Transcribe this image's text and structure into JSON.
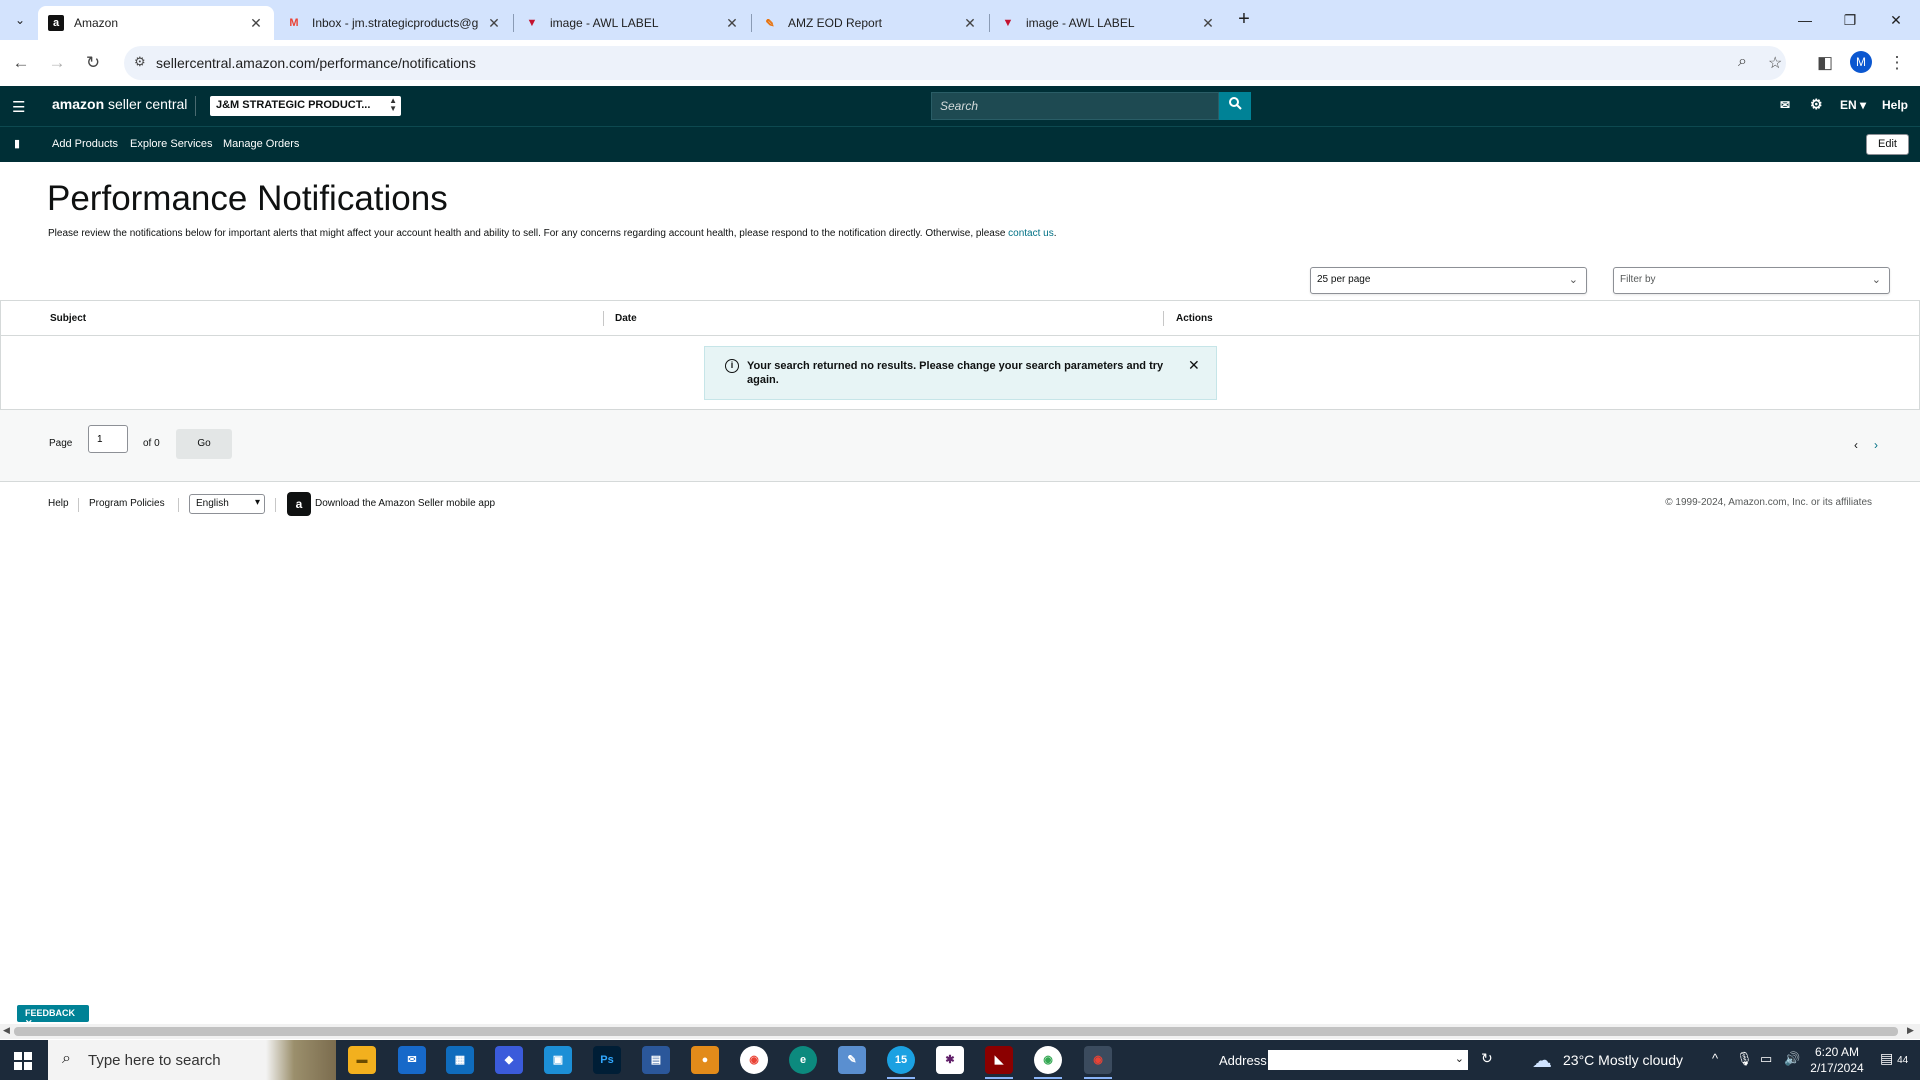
{
  "browser": {
    "tabs": [
      {
        "title": "Amazon",
        "icon": "amazon-favicon",
        "active": true
      },
      {
        "title": "Inbox - jm.strategicproducts@g",
        "icon": "gmail-favicon",
        "active": false
      },
      {
        "title": "image - AWL LABEL",
        "icon": "awl-favicon",
        "active": false
      },
      {
        "title": "AMZ EOD Report",
        "icon": "report-favicon",
        "active": false
      },
      {
        "title": "image - AWL LABEL",
        "icon": "awl-favicon",
        "active": false
      }
    ],
    "url": "sellercentral.amazon.com/performance/notifications",
    "profile_initial": "M"
  },
  "header": {
    "logo_bold": "amazon",
    "logo_rest": " seller central",
    "account": "J&M STRATEGIC PRODUCT...",
    "search_placeholder": "Search",
    "language": "EN",
    "help": "Help"
  },
  "nav": {
    "links": [
      "Add Products",
      "Explore Services",
      "Manage Orders"
    ],
    "edit": "Edit"
  },
  "page": {
    "title": "Performance Notifications",
    "description": "Please review the notifications below for important alerts that might affect your account health and ability to sell. For any concerns regarding account health, please respond to the notification directly. Otherwise, please ",
    "contact_link": "contact us",
    "per_page": "25 per page",
    "filter_placeholder": "Filter by"
  },
  "table": {
    "columns": [
      "Subject",
      "Date",
      "Actions"
    ],
    "empty_message": "Your search returned no results. Please change your search parameters and try again."
  },
  "pager": {
    "page_label": "Page",
    "page_value": "1",
    "of_label": "of 0",
    "go": "Go"
  },
  "footer": {
    "help": "Help",
    "policies": "Program Policies",
    "language": "English",
    "app_link": "Download the Amazon Seller mobile app",
    "copyright": "© 1999-2024, Amazon.com, Inc. or its affiliates"
  },
  "feedback": "FEEDBACK",
  "taskbar": {
    "search_placeholder": "Type here to search",
    "address_label": "Address",
    "weather": "23°C  Mostly cloudy",
    "time": "6:20 AM",
    "date": "2/17/2024",
    "notification_count": "44",
    "mail_badge": "15"
  }
}
